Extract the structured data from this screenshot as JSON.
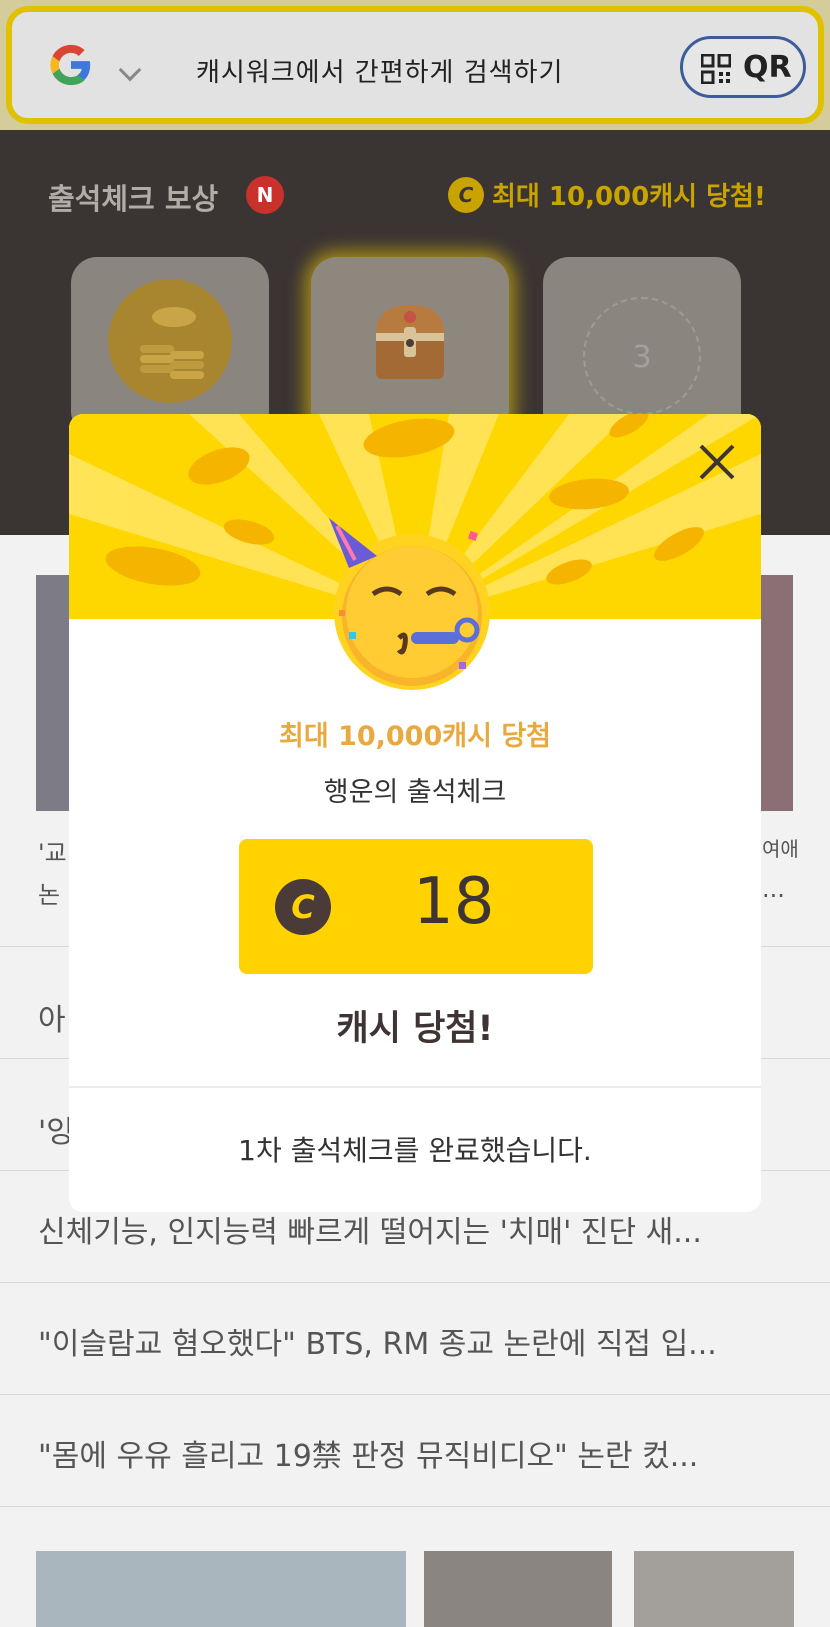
{
  "search": {
    "placeholder": "캐시워크에서 간편하게 검색하기",
    "qr_label": "QR"
  },
  "attendance": {
    "title": "출석체크 보상",
    "new_badge": "N",
    "promo_coin": "C",
    "promo": "최대 10,000캐시 당첨!",
    "day3_number": "3"
  },
  "news": {
    "fragments": [
      "'교",
      "논",
      "아",
      "'잉",
      "여애",
      "..."
    ],
    "items": [
      "신체기능, 인지능력 빠르게 떨어지는 '치매' 진단 새...",
      "\"이슬람교 혐오했다\" BTS, RM 종교 논란에 직접 입...",
      "\"몸에 우유 흘리고 19禁 판정 뮤직비디오\" 논란 컸..."
    ]
  },
  "modal": {
    "max_text": "최대 10,000캐시 당첨",
    "sub_text": "행운의 출석체크",
    "coin_symbol": "C",
    "amount": "18",
    "won_text": "캐시 당첨!",
    "complete_text": "1차 출석체크를 완료했습니다."
  },
  "colors": {
    "accent_yellow": "#ffd700",
    "dark_panel": "#3a3433",
    "promo_gold": "#c9a300",
    "badge_red": "#c8322b",
    "max_text_orange": "#e9a93f"
  }
}
